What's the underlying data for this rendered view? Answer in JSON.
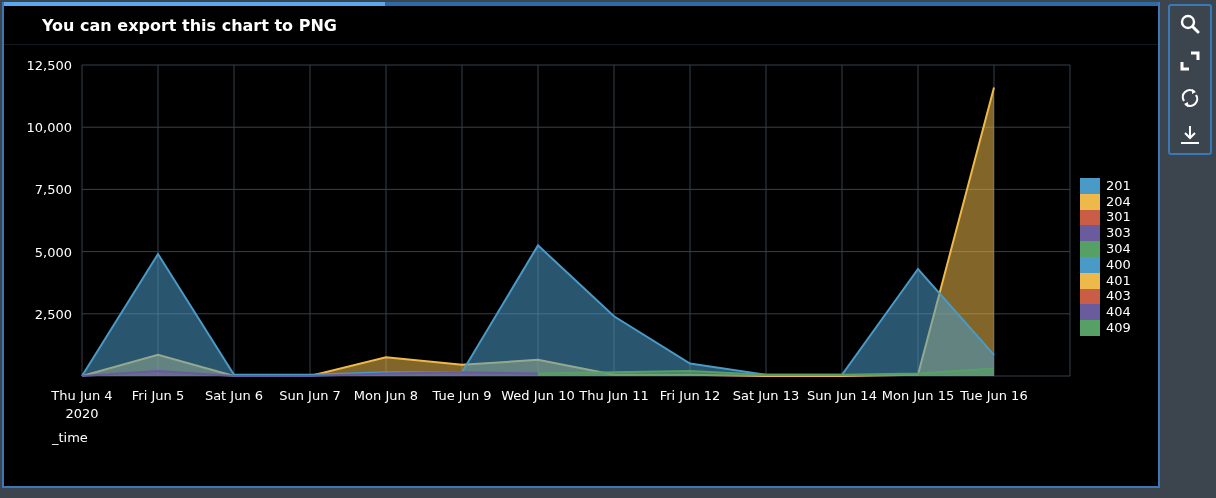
{
  "panel": {
    "title": "You can export this chart to PNG",
    "progress": {
      "level": 0.33
    },
    "chart_data": {
      "type": "area",
      "grid": true,
      "xlabel": "_time",
      "categories": [
        "Thu Jun 4\n2020",
        "Fri Jun 5",
        "Sat Jun 6",
        "Sun Jun 7",
        "Mon Jun 8",
        "Tue Jun 9",
        "Wed Jun 10",
        "Thu Jun 11",
        "Fri Jun 12",
        "Sat Jun 13",
        "Sun Jun 14",
        "Mon Jun 15",
        "Tue Jun 16"
      ],
      "ylim": [
        0,
        12500
      ],
      "yticks": [
        {
          "value": 2500,
          "label": "2,500"
        },
        {
          "value": 5000,
          "label": "5,000"
        },
        {
          "value": 7500,
          "label": "7,500"
        },
        {
          "value": 10000,
          "label": "10,000"
        },
        {
          "value": 12500,
          "label": "12,500"
        }
      ],
      "series": [
        {
          "color": "#4a9ac8",
          "values": [
            0,
            4900,
            50,
            50,
            150,
            150,
            5250,
            2400,
            500,
            50,
            50,
            4300,
            850
          ]
        },
        {
          "color": "#ecb94a",
          "values": [
            0,
            850,
            0,
            0,
            750,
            450,
            650,
            50,
            50,
            0,
            0,
            50,
            11600
          ]
        },
        {
          "color": "#6a5b9c",
          "values": [
            0,
            200,
            0,
            0,
            100,
            150,
            100,
            null,
            null,
            null,
            null,
            null,
            null
          ]
        },
        {
          "color": "#57a065",
          "values": [
            null,
            null,
            null,
            null,
            null,
            null,
            100,
            150,
            200,
            50,
            50,
            100,
            300
          ]
        }
      ]
    },
    "legend": [
      {
        "name": "201",
        "color": "#4a9ac8"
      },
      {
        "name": "204",
        "color": "#ecb94a"
      },
      {
        "name": "301",
        "color": "#c95d45"
      },
      {
        "name": "303",
        "color": "#6a5b9c"
      },
      {
        "name": "304",
        "color": "#57a065"
      },
      {
        "name": "400",
        "color": "#4a9ac8"
      },
      {
        "name": "401",
        "color": "#ecb94a"
      },
      {
        "name": "403",
        "color": "#c95d45"
      },
      {
        "name": "404",
        "color": "#6a5b9c"
      },
      {
        "name": "409",
        "color": "#57a065"
      }
    ]
  },
  "toolbar": [
    {
      "kind": "search"
    },
    {
      "kind": "expand"
    },
    {
      "kind": "refresh"
    },
    {
      "kind": "download"
    }
  ]
}
